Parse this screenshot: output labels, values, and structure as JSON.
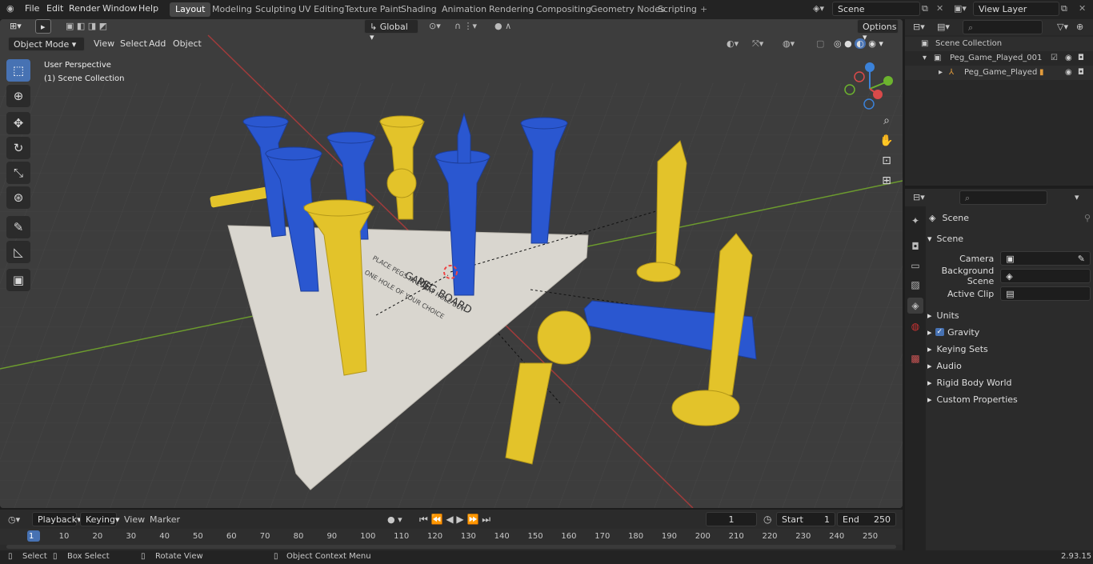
{
  "menu": {
    "file": "File",
    "edit": "Edit",
    "render": "Render",
    "window": "Window",
    "help": "Help"
  },
  "workspaces": [
    "Layout",
    "Modeling",
    "Sculpting",
    "UV Editing",
    "Texture Paint",
    "Shading",
    "Animation",
    "Rendering",
    "Compositing",
    "Geometry Nodes",
    "Scripting"
  ],
  "scene_name": "Scene",
  "view_layer": "View Layer",
  "viewport": {
    "mode": "Object Mode",
    "view": "View",
    "select": "Select",
    "add": "Add",
    "object": "Object",
    "orientation": "Global",
    "options": "Options",
    "perspective_label": "User Perspective",
    "collection_label": "(1) Scene Collection",
    "board_text_1": "PEG BOARD",
    "board_text_2": "GAME",
    "board_text_3": "PLACE PEGS IN EVERY HOLE BUT",
    "board_text_4": "ONE HOLE OF YOUR CHOICE"
  },
  "outliner": {
    "root": "Scene Collection",
    "items": [
      {
        "name": "Peg_Game_Played_001"
      },
      {
        "name": "Peg_Game_Played"
      }
    ]
  },
  "properties": {
    "header": "Scene",
    "panel_title": "Scene",
    "camera_label": "Camera",
    "background_label": "Background Scene",
    "clip_label": "Active Clip",
    "sections": [
      "Units",
      "Gravity",
      "Keying Sets",
      "Audio",
      "Rigid Body World",
      "Custom Properties"
    ]
  },
  "timeline": {
    "playback": "Playback",
    "keying": "Keying",
    "view": "View",
    "marker": "Marker",
    "current_frame": "1",
    "start_label": "Start",
    "start": "1",
    "end_label": "End",
    "end": "250",
    "ticks": [
      "1",
      "10",
      "20",
      "30",
      "40",
      "50",
      "60",
      "70",
      "80",
      "90",
      "100",
      "110",
      "120",
      "130",
      "140",
      "150",
      "160",
      "170",
      "180",
      "190",
      "200",
      "210",
      "220",
      "230",
      "240",
      "250"
    ]
  },
  "status": {
    "select": "Select",
    "box_select": "Box Select",
    "rotate": "Rotate View",
    "context": "Object Context Menu",
    "version": "2.93.15"
  },
  "colors": {
    "accent": "#4772b3",
    "blue_peg": "#2a57d0",
    "yellow_peg": "#e3c32a",
    "board": "#d9d6cf"
  }
}
